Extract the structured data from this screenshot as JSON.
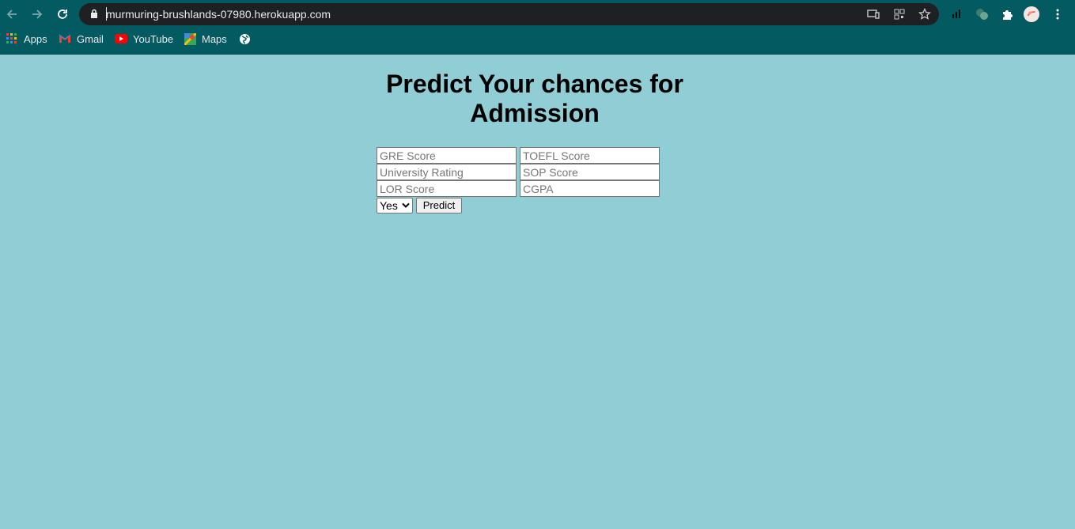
{
  "browser": {
    "url": "murmuring-brushlands-07980.herokuapp.com",
    "bookmarks": [
      {
        "label": "Apps",
        "icon": "apps-grid-icon"
      },
      {
        "label": "Gmail",
        "icon": "gmail-icon"
      },
      {
        "label": "YouTube",
        "icon": "youtube-icon"
      },
      {
        "label": "Maps",
        "icon": "maps-icon"
      },
      {
        "label": "",
        "icon": "globe-icon"
      }
    ],
    "colors": {
      "toolbar": "#035a60",
      "omnibox": "#1f2023",
      "page_bg": "#90cdd4"
    }
  },
  "page": {
    "title": "Predict Your chances for Admission",
    "fields": {
      "gre": {
        "placeholder": "GRE Score",
        "value": ""
      },
      "toefl": {
        "placeholder": "TOEFL Score",
        "value": ""
      },
      "university": {
        "placeholder": "University Rating",
        "value": ""
      },
      "sop": {
        "placeholder": "SOP Score",
        "value": ""
      },
      "lor": {
        "placeholder": "LOR Score",
        "value": ""
      },
      "cgpa": {
        "placeholder": "CGPA",
        "value": ""
      }
    },
    "research_select": {
      "selected": "Yes"
    },
    "predict_button": "Predict"
  }
}
